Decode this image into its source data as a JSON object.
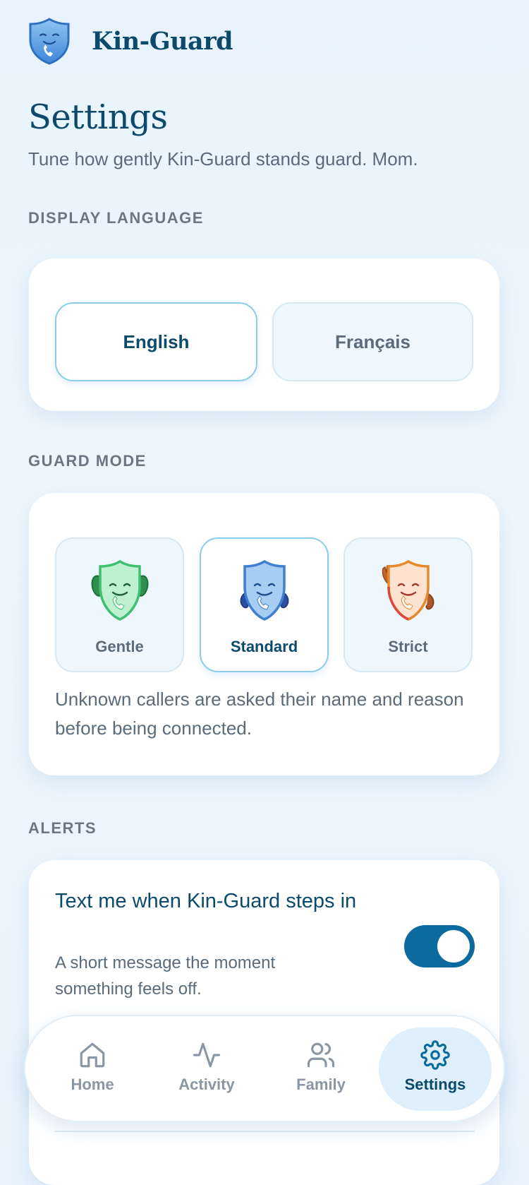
{
  "app": {
    "name": "Kin-Guard"
  },
  "page": {
    "title": "Settings",
    "subtitle": "Tune how gently Kin-Guard stands guard. Mom."
  },
  "display_language": {
    "section_label": "DISPLAY LANGUAGE",
    "options": [
      {
        "label": "English",
        "selected": true
      },
      {
        "label": "Français",
        "selected": false
      }
    ]
  },
  "guard_mode": {
    "section_label": "GUARD MODE",
    "options": [
      {
        "label": "Gentle",
        "icon": "gentle-shield-mascot-icon",
        "color": "#3fbf6f",
        "selected": false
      },
      {
        "label": "Standard",
        "icon": "standard-shield-mascot-icon",
        "color": "#3f7fd0",
        "selected": true
      },
      {
        "label": "Strict",
        "icon": "strict-shield-mascot-icon",
        "color": "#e6892c",
        "selected": false
      }
    ],
    "description": "Unknown callers are asked their name and reason before being connected."
  },
  "alerts": {
    "section_label": "ALERTS",
    "items": [
      {
        "title": "Text me when Kin-Guard steps in",
        "description": "A short message the moment something feels off.",
        "enabled": true
      }
    ]
  },
  "nav": {
    "items": [
      {
        "label": "Home",
        "icon": "home-icon",
        "active": false
      },
      {
        "label": "Activity",
        "icon": "activity-icon",
        "active": false
      },
      {
        "label": "Family",
        "icon": "family-icon",
        "active": false
      },
      {
        "label": "Settings",
        "icon": "gear-icon",
        "active": true
      }
    ]
  },
  "colors": {
    "primary": "#0b4a6b",
    "toggle_on": "#0b6a9e",
    "accent_border": "#89cdea",
    "background": "#eaf4fd"
  }
}
